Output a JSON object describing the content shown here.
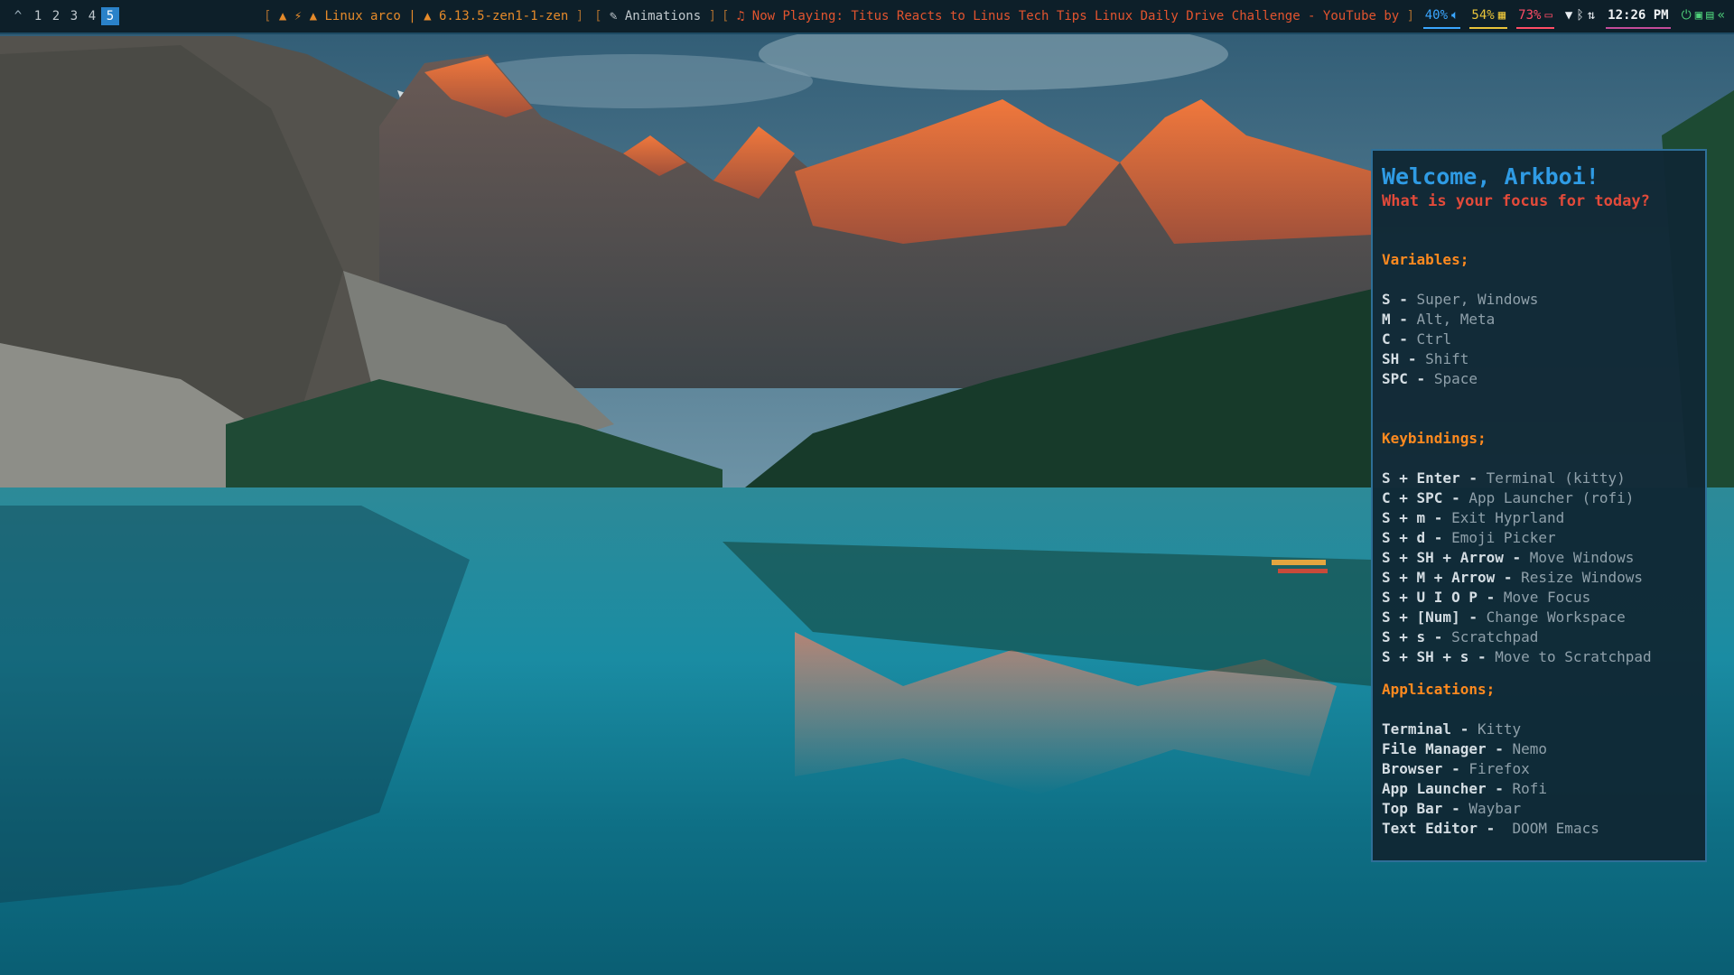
{
  "topbar": {
    "workspace_icon": "^",
    "workspaces": [
      "1",
      "2",
      "3",
      "4",
      "5"
    ],
    "active_workspace": "5",
    "system_info": "Linux arco",
    "kernel": "6.13.5-zen1-1-zen",
    "animations_label": "Animations",
    "now_playing": "Now Playing: Titus Reacts to Linus Tech Tips Linux Daily Drive Challenge - YouTube by",
    "volume": "40%",
    "cpu": "54%",
    "battery": "73%",
    "clock": "12:26 PM",
    "icons": [
      "speaker-icon",
      "memory-icon",
      "battery-icon",
      "bluetooth-icon",
      "network-icon",
      "wifi-icon",
      "power-icon",
      "window-icon",
      "calendar-icon",
      "chevron-left-icon"
    ]
  },
  "help": {
    "welcome": "Welcome, Arkboi!",
    "question": "What is your focus for today?",
    "variables_title": "Variables;",
    "variables": [
      {
        "key": "S",
        "desc": "Super, Windows"
      },
      {
        "key": "M",
        "desc": "Alt, Meta"
      },
      {
        "key": "C",
        "desc": "Ctrl"
      },
      {
        "key": "SH",
        "desc": "Shift"
      },
      {
        "key": "SPC",
        "desc": "Space"
      }
    ],
    "keybindings_title": "Keybindings;",
    "keybindings": [
      {
        "key": "S + Enter",
        "desc": "Terminal (kitty)"
      },
      {
        "key": "C + SPC",
        "desc": "App Launcher (rofi)"
      },
      {
        "key": "S + m",
        "desc": "Exit Hyprland"
      },
      {
        "key": "S + d",
        "desc": "Emoji Picker"
      },
      {
        "key": "S + SH + Arrow",
        "desc": "Move Windows"
      },
      {
        "key": "S + M + Arrow",
        "desc": "Resize Windows"
      },
      {
        "key": "S + U I O P",
        "desc": "Move Focus"
      },
      {
        "key": "S + [Num]",
        "desc": "Change Workspace"
      },
      {
        "key": "S + s",
        "desc": "Scratchpad"
      },
      {
        "key": "S + SH + s",
        "desc": "Move to Scratchpad"
      }
    ],
    "applications_title": "Applications;",
    "applications": [
      {
        "key": "Terminal",
        "desc": "Kitty"
      },
      {
        "key": "File Manager",
        "desc": "Nemo"
      },
      {
        "key": "Browser",
        "desc": "Firefox"
      },
      {
        "key": "App Launcher",
        "desc": "Rofi"
      },
      {
        "key": "Top Bar",
        "desc": "Waybar"
      },
      {
        "key": "Text Editor",
        "desc": " DOOM Emacs"
      }
    ]
  },
  "colors": {
    "bar_bg": "#0d1f29",
    "accent_blue": "#2f9be4",
    "accent_red": "#e24a3a",
    "accent_orange": "#ff8a1f"
  }
}
